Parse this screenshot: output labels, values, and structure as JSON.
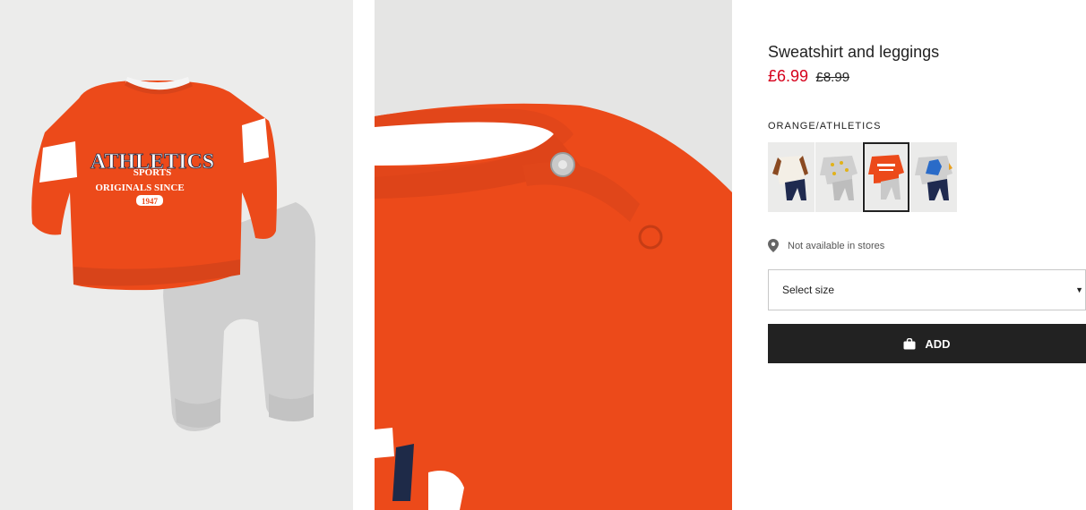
{
  "product": {
    "title": "Sweatshirt and leggings",
    "price_current": "£6.99",
    "price_original": "£8.99"
  },
  "colors": {
    "label": "ORANGE/ATHLETICS",
    "swatches": [
      "brown-raglan",
      "grey-print",
      "orange-athletics",
      "grey-dino"
    ],
    "selected_index": 2
  },
  "availability": {
    "text": "Not available in stores"
  },
  "size_select": {
    "label": "Select size"
  },
  "add_button": {
    "label": "ADD"
  },
  "images": {
    "main_print_lines": [
      "ATHLETICS",
      "SPORTS",
      "ORIGINALS SINCE",
      "1947"
    ]
  },
  "theme": {
    "price_sale": "#d6001c",
    "sweatshirt_orange": "#ec4a1a",
    "button_dark": "#222222"
  }
}
